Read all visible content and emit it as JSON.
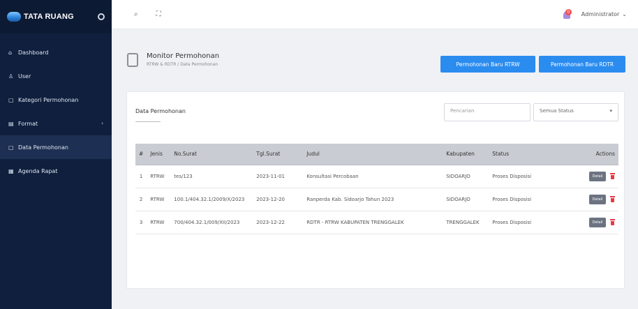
{
  "brand": {
    "name": "TATA RUANG"
  },
  "sidebar": {
    "items": [
      {
        "icon": "home-icon",
        "glyph": "⌂",
        "label": "Dashboard",
        "active": false
      },
      {
        "icon": "user-icon",
        "glyph": "♙",
        "label": "User",
        "active": false
      },
      {
        "icon": "category-icon",
        "glyph": "▢",
        "label": "Kategori Permohonan",
        "active": false
      },
      {
        "icon": "format-icon",
        "glyph": "▤",
        "label": "Format",
        "active": false
      },
      {
        "icon": "data-icon",
        "glyph": "▢",
        "label": "Data Permohonan",
        "active": true
      },
      {
        "icon": "calendar-icon",
        "glyph": "▦",
        "label": "Agenda Rapat",
        "active": false
      }
    ]
  },
  "topbar": {
    "notification_count": "0",
    "user_name": "Administrator"
  },
  "page": {
    "title": "Monitor Permohonan",
    "breadcrumb": "RTRW & RDTR / Data Permohonan"
  },
  "buttons": {
    "new_rtrw": "Permohonan Baru RTRW",
    "new_rdtr": "Permohonan Baru RDTR"
  },
  "card": {
    "title": "Data Permohonan",
    "search_placeholder": "Pencarian",
    "status_filter": "Semua Status"
  },
  "table": {
    "headers": [
      "#",
      "Jenis",
      "No.Surat",
      "Tgl.Surat",
      "Judul",
      "Kabupaten",
      "Status",
      "Actions"
    ],
    "rows": [
      {
        "no": "1",
        "jenis": "RTRW",
        "no_surat": "tes/123",
        "tgl": "2023-11-01",
        "judul": "Konsultasi Percobaan",
        "kabupaten": "SIDOARJO",
        "status": "Proses Disposisi",
        "detail": "Detail"
      },
      {
        "no": "2",
        "jenis": "RTRW",
        "no_surat": "100.1/404.32.1/2009/X/2023",
        "tgl": "2023-12-20",
        "judul": "Ranperda Kab. Sidoarjo Tahun 2023",
        "kabupaten": "SIDOARJO",
        "status": "Proses Disposisi",
        "detail": "Detail"
      },
      {
        "no": "3",
        "jenis": "RTRW",
        "no_surat": "700/404.32.1/009/XII/2023",
        "tgl": "2023-12-22",
        "judul": "RDTR - RTRW KABUPATEN TRENGGALEK",
        "kabupaten": "TRENGGALEK",
        "status": "Proses Disposisi",
        "detail": "Detail"
      }
    ]
  },
  "colors": {
    "sidebar": "#0f1f3d",
    "primary": "#2b8cf0",
    "danger": "#e63946",
    "table_header": "#c9ccd2"
  }
}
